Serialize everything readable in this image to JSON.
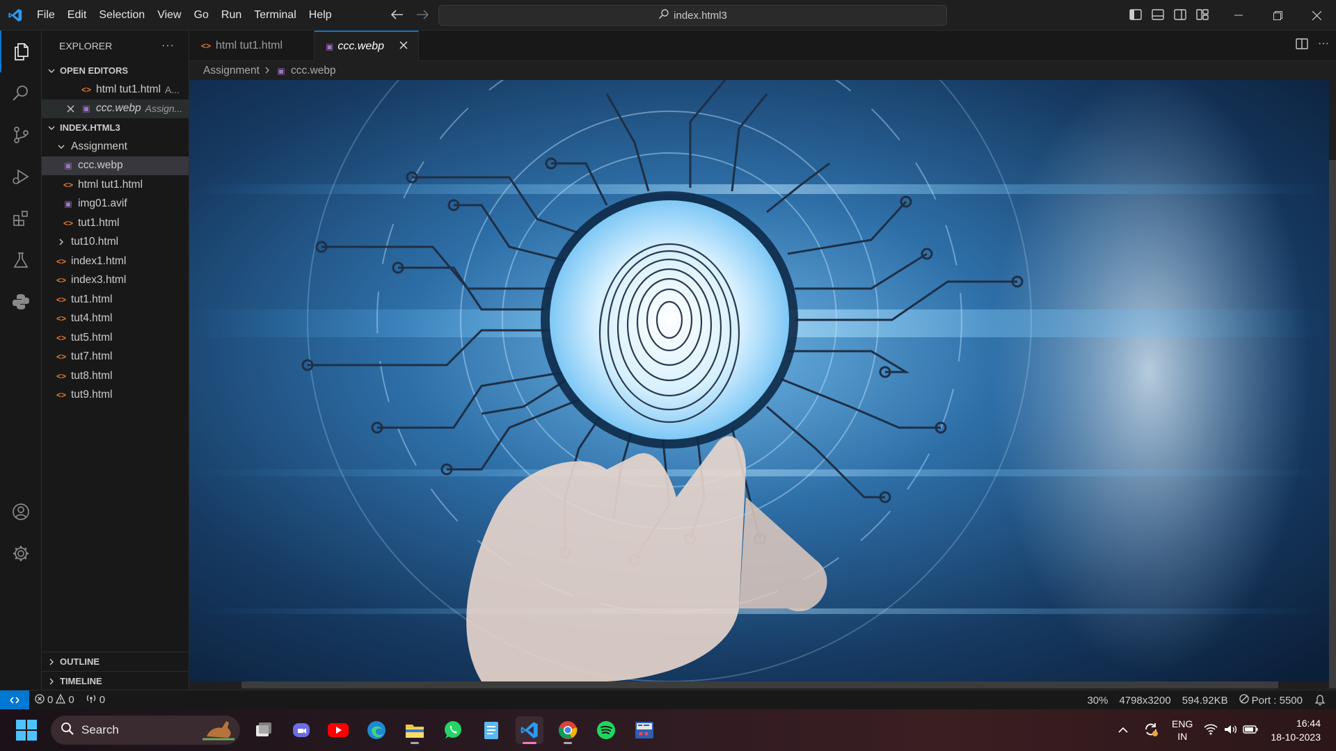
{
  "menu": [
    "File",
    "Edit",
    "Selection",
    "View",
    "Go",
    "Run",
    "Terminal",
    "Help"
  ],
  "command_center": "index.html3",
  "explorer": {
    "title": "EXPLORER",
    "open_editors_label": "OPEN EDITORS",
    "open_editors": [
      {
        "name": "html tut1.html",
        "desc": "A...",
        "type": "html"
      },
      {
        "name": "ccc.webp",
        "desc": "Assign...",
        "type": "image"
      }
    ],
    "workspace_label": "INDEX.HTML3",
    "folder": "Assignment",
    "folder_files": [
      {
        "name": "ccc.webp",
        "type": "image"
      },
      {
        "name": "html tut1.html",
        "type": "html"
      },
      {
        "name": "img01.avif",
        "type": "image"
      },
      {
        "name": "tut1.html",
        "type": "html"
      }
    ],
    "collapsed_item": "tut10.html",
    "root_files": [
      "index1.html",
      "index3.html",
      "tut1.html",
      "tut4.html",
      "tut5.html",
      "tut7.html",
      "tut8.html",
      "tut9.html"
    ],
    "outline_label": "OUTLINE",
    "timeline_label": "TIMELINE"
  },
  "tabs": [
    {
      "label": "html tut1.html",
      "active": false
    },
    {
      "label": "ccc.webp",
      "active": true
    }
  ],
  "breadcrumb": {
    "folder": "Assignment",
    "file": "ccc.webp"
  },
  "status": {
    "errors": "0",
    "warnings": "0",
    "ports": "0",
    "zoom": "30%",
    "dimensions": "4798x3200",
    "size": "594.92KB",
    "port": "Port : 5500"
  },
  "taskbar": {
    "search_placeholder": "Search",
    "lang": "ENG",
    "region": "IN",
    "time": "16:44",
    "date": "18-10-2023"
  },
  "colors": {
    "accent": "#0078d4",
    "html_icon": "#e37933",
    "image_icon": "#a074c4"
  }
}
